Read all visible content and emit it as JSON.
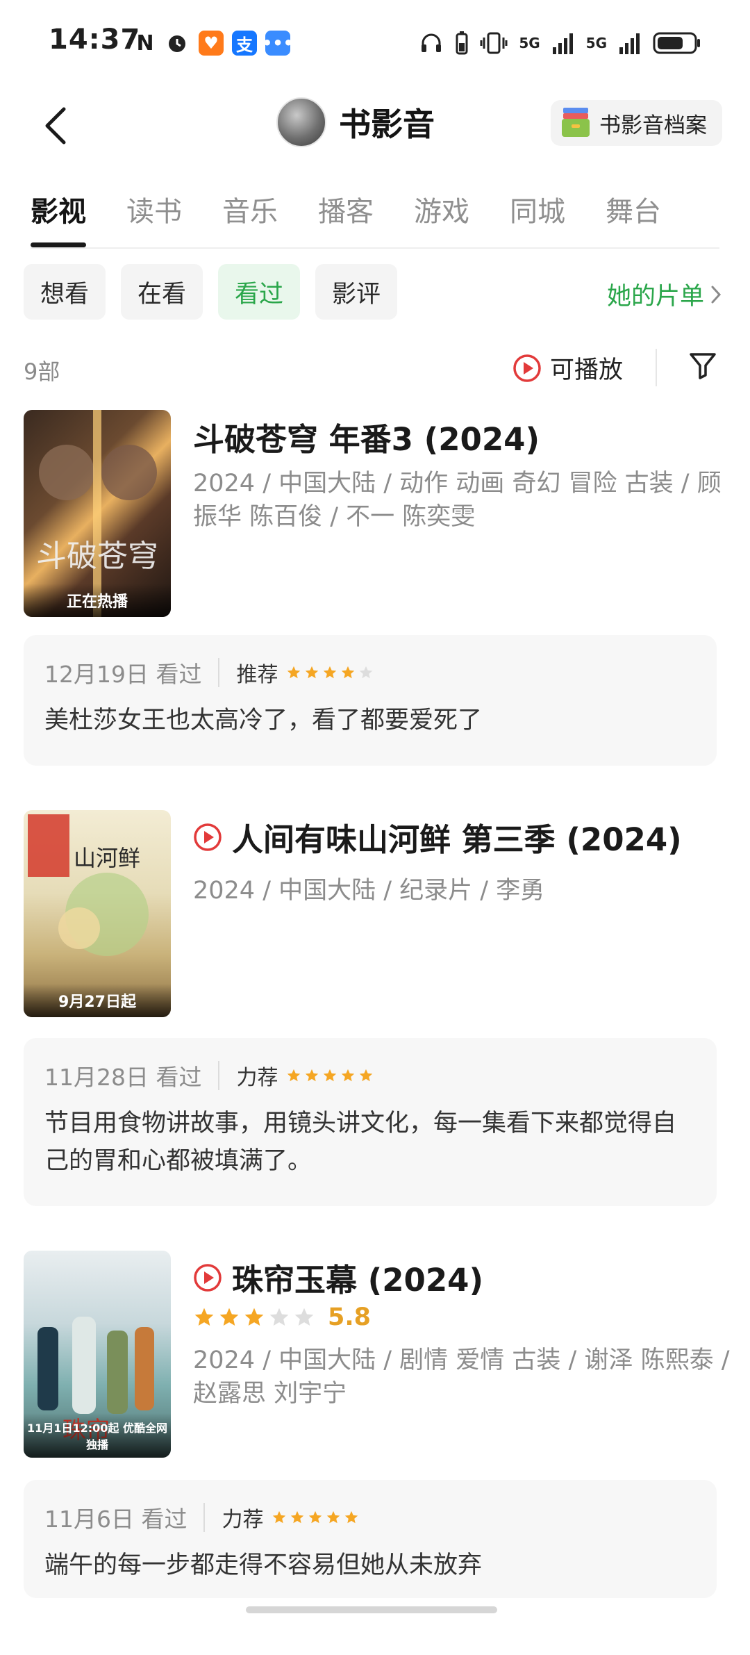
{
  "status_bar": {
    "time": "14:37",
    "signal1": "5G",
    "signal2": "5G"
  },
  "header": {
    "title": "书影音",
    "archive_label": "书影音档案"
  },
  "tabs": [
    "影视",
    "读书",
    "音乐",
    "播客",
    "游戏",
    "同城",
    "舞台"
  ],
  "filters": {
    "pills": [
      "想看",
      "在看",
      "看过",
      "影评"
    ],
    "active": "看过",
    "her_list": "她的片单"
  },
  "meta": {
    "count": "9部",
    "playable_label": "可播放"
  },
  "items": [
    {
      "title": "斗破苍穹 年番3 (2024)",
      "meta": "2024 / 中国大陆 / 动作 动画 奇幻 冒险 古装 / 顾振华 陈百俊 / 不一 陈奕雯",
      "poster_label": "正在热播",
      "review_date": "12月19日 看过",
      "review_level": "推荐",
      "review_stars": 4,
      "review_text": "美杜莎女王也太高冷了，看了都要爱死了"
    },
    {
      "title": "人间有味山河鲜 第三季 (2024)",
      "meta": "2024 / 中国大陆 / 纪录片 / 李勇",
      "poster_label": "9月27日起",
      "review_date": "11月28日 看过",
      "review_level": "力荐",
      "review_stars": 5,
      "review_text": "节目用食物讲故事，用镜头讲文化，每一集看下来都觉得自己的胃和心都被填满了。"
    },
    {
      "title": "珠帘玉幕 (2024)",
      "rating": "5.8",
      "rating_stars": 3,
      "meta": "2024 / 中国大陆 / 剧情 爱情 古装 / 谢泽 陈熙泰 / 赵露思 刘宇宁",
      "poster_label": "11月1日12:00起 优酷全网独播",
      "review_date": "11月6日 看过",
      "review_level": "力荐",
      "review_stars": 5,
      "review_text": "端午的每一步都走得不容易但她从未放弃"
    }
  ],
  "colors": {
    "accent_green": "#2aa64a",
    "star_orange": "#f5a623",
    "play_red": "#e23a3a"
  }
}
